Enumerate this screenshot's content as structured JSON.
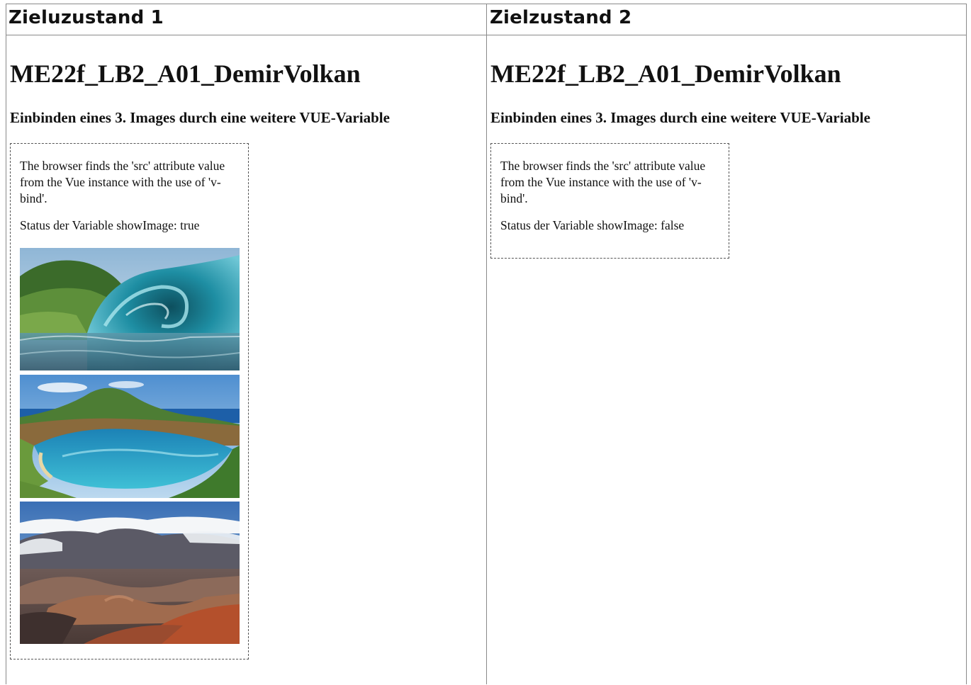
{
  "table": {
    "headers": [
      "Zieluzustand 1",
      "Zielzustand 2"
    ]
  },
  "panels": [
    {
      "title": "ME22f_LB2_A01_DemirVolkan",
      "subtitle": "Einbinden eines 3. Images durch eine weitere VUE-Variable",
      "description": "The browser finds the 'src' attribute value from the Vue instance with the use of 'v-bind'.",
      "status": "Status der Variable showImage: true",
      "images_shown": true
    },
    {
      "title": "ME22f_LB2_A01_DemirVolkan",
      "subtitle": "Einbinden eines 3. Images durch eine weitere VUE-Variable",
      "description": "The browser finds the 'src' attribute value from the Vue instance with the use of 'v-bind'.",
      "status": "Status der Variable showImage: false",
      "images_shown": false
    }
  ],
  "images": [
    "wave-photo",
    "bay-photo",
    "volcano-photo"
  ]
}
